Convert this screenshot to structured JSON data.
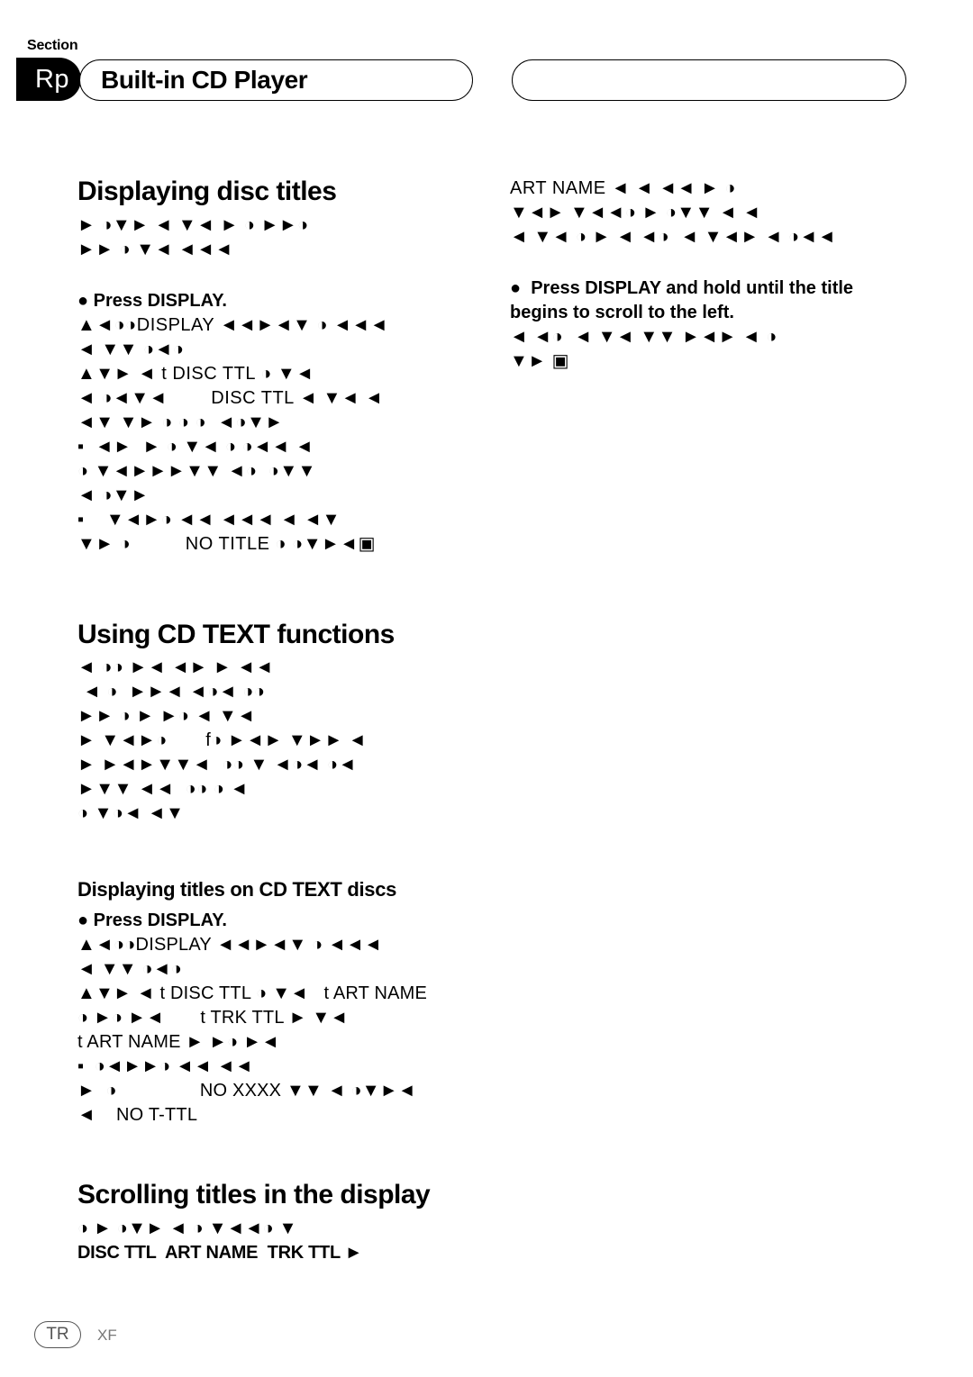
{
  "header": {
    "section_label": "Section",
    "badge_text": "Rp",
    "title": "Built-in CD Player",
    "empty_pill": ""
  },
  "left_column": {
    "section1": {
      "heading": "Displaying disc titles",
      "intro_lines": [
        "► ◑▼► ◄ ▼◄ ► ◑ ►►◑",
        "►► ◑ ▼◄ ◄◄◄"
      ],
      "bullet": "●  Press DISPLAY.",
      "body_lines": [
        "▲◄◑◑DISPLAY ◄◄►◄▼ ◑ ◄◄◄",
        "◄ ▼▼ ◑◄◑",
        "▲▼► ◄ t DISC TTL ◑ ▼◄",
        "◄ ◑◄▼◄        DISC TTL ◄ ▼◄ ◄",
        "◄▼ ▼► ◑ ◑ ◑  ◄◑▼►",
        "▪  ◄►  ► ◑ ▼◄ ◑ ◑◄◄ ◄",
        "◑ ▼◄►►►▼▼ ◄◑  ◑▼▼",
        "◄ ◑▼►",
        "▪    ▼◄►◑ ◄◄ ◄◄◄ ◄ ◄▼",
        "▼► ◑          NO TITLE ◑ ◑▼►◄▣"
      ]
    },
    "section2": {
      "heading": "Using CD TEXT functions",
      "body_lines": [
        "◄ ◑◑ ►◄ ◄► ► ◄◄",
        " ◄ ◑  ►►◄ ◄◑◄ ◑◑",
        "►► ◑ ► ►◑ ◄ ▼◄",
        "► ▼◄►◑       f◑ ►◄► ▼►► ◄",
        "► ►◄►▼▼◄  ◑◑ ▼ ◄◑◄ ◑◄",
        "►▼▼ ◄◄  ◑◑ ◑ ◄",
        "◑ ▼◑◄ ◄▼"
      ]
    },
    "section3": {
      "heading": "Displaying titles on CD TEXT discs",
      "bullet": "●  Press DISPLAY.",
      "body_lines": [
        "▲◄◑◑DISPLAY ◄◄►◄▼ ◑ ◄◄◄",
        "◄ ▼▼ ◑◄◑",
        "▲▼► ◄ t DISC TTL ◑ ▼◄   t ART NAME",
        "◑ ►◑ ►◄       t TRK TTL ► ▼◄",
        "t ART NAME ► ►◑ ►◄",
        "▪  ◑◄►►◑ ◄◄ ◄◄",
        "►  ◑                NO XXXX ▼▼ ◄ ◑▼►◄",
        "◄    NO T-TTL"
      ]
    },
    "section4": {
      "heading": "Scrolling titles in the display",
      "body_lines": [
        "◑ ► ◑▼► ◄ ◑ ▼◄◄◑ ▼",
        "DISC TTL  ART NAME  TRK TTL ►"
      ]
    }
  },
  "right_column": {
    "top_lines": [
      "ART NAME ◄ ◄ ◄◄ ► ◑",
      "▼◄► ▼◄◄◑ ► ◑▼▼ ◄ ◄",
      "◄ ▼◄ ◑ ► ◄ ◄◑  ◄ ▼◄► ◄ ◑◄◄"
    ],
    "bullet_lines": [
      "●  Press DISPLAY and hold until the title",
      "begins to scroll to the left."
    ],
    "body_lines": [
      "◄ ◄◑  ◄ ▼◄ ▼▼ ►◄► ◄ ◑",
      "▼► ▣"
    ]
  },
  "footer": {
    "badge": "TR",
    "label": "XF"
  }
}
